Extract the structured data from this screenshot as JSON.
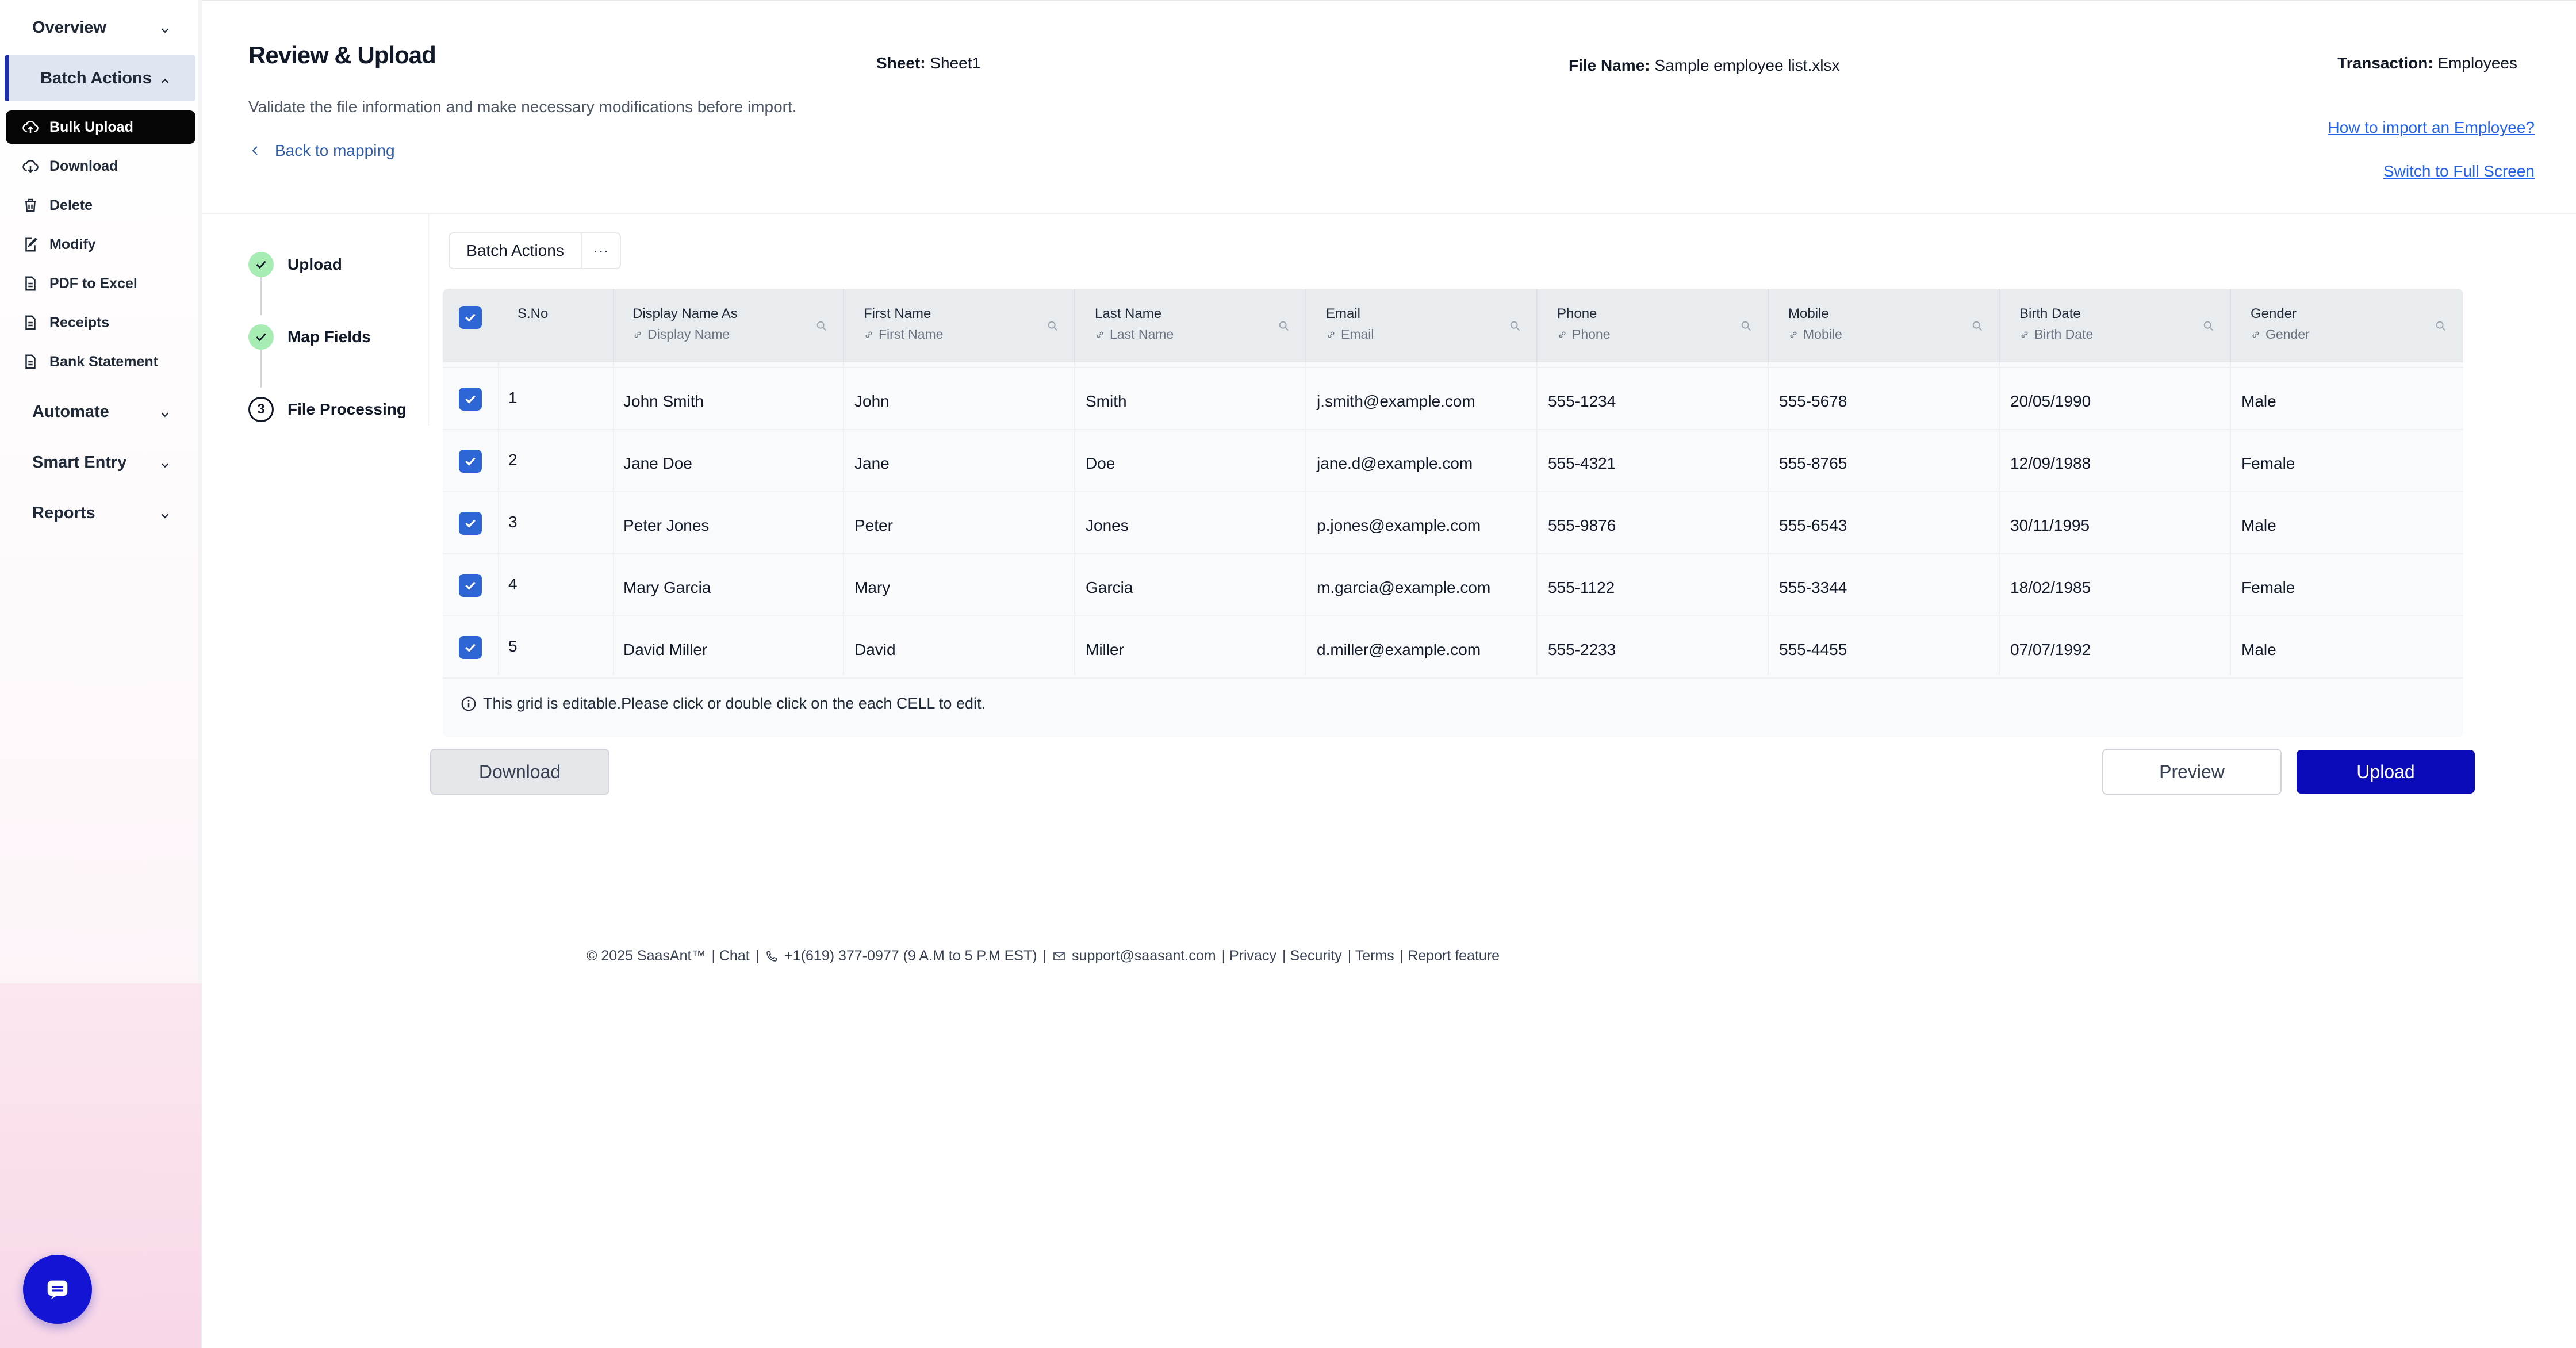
{
  "sidebar": {
    "groups": [
      {
        "label": "Overview"
      },
      {
        "label": "Batch Actions"
      },
      {
        "label": "Automate"
      },
      {
        "label": "Smart Entry"
      },
      {
        "label": "Reports"
      }
    ],
    "items": [
      {
        "label": "Bulk Upload",
        "icon": "cloud-upload-icon"
      },
      {
        "label": "Download",
        "icon": "cloud-download-icon"
      },
      {
        "label": "Delete",
        "icon": "trash-icon"
      },
      {
        "label": "Modify",
        "icon": "edit-icon"
      },
      {
        "label": "PDF to Excel",
        "icon": "document-icon"
      },
      {
        "label": "Receipts",
        "icon": "document-icon"
      },
      {
        "label": "Bank Statement",
        "icon": "document-icon"
      }
    ]
  },
  "header": {
    "title": "Review & Upload",
    "subtitle": "Validate the file information and make necessary modifications before import.",
    "back_link": "Back to mapping",
    "sheet_label": "Sheet:",
    "sheet_value": "Sheet1",
    "file_label": "File Name:",
    "file_value": "Sample employee list.xlsx",
    "transaction_label": "Transaction:",
    "transaction_value": "Employees",
    "help_link": "How to import an Employee?",
    "fullscreen_link": "Switch to Full Screen"
  },
  "steps": [
    {
      "label": "Upload",
      "status": "done"
    },
    {
      "label": "Map Fields",
      "status": "done"
    },
    {
      "label": "File Processing",
      "number": "3"
    }
  ],
  "toolbar": {
    "batch_actions": "Batch Actions",
    "more": "···"
  },
  "grid": {
    "columns": [
      {
        "title": "S.No",
        "sub": ""
      },
      {
        "title": "Display Name As",
        "sub": "Display Name"
      },
      {
        "title": "First Name",
        "sub": "First Name"
      },
      {
        "title": "Last Name",
        "sub": "Last Name"
      },
      {
        "title": "Email",
        "sub": "Email"
      },
      {
        "title": "Phone",
        "sub": "Phone"
      },
      {
        "title": "Mobile",
        "sub": "Mobile"
      },
      {
        "title": "Birth Date",
        "sub": "Birth Date"
      },
      {
        "title": "Gender",
        "sub": "Gender"
      }
    ],
    "rows": [
      [
        "1",
        "John Smith",
        "John",
        "Smith",
        "j.smith@example.com",
        "555-1234",
        "555-5678",
        "20/05/1990",
        "Male"
      ],
      [
        "2",
        "Jane Doe",
        "Jane",
        "Doe",
        "jane.d@example.com",
        "555-4321",
        "555-8765",
        "12/09/1988",
        "Female"
      ],
      [
        "3",
        "Peter Jones",
        "Peter",
        "Jones",
        "p.jones@example.com",
        "555-9876",
        "555-6543",
        "30/11/1995",
        "Male"
      ],
      [
        "4",
        "Mary Garcia",
        "Mary",
        "Garcia",
        "m.garcia@example.com",
        "555-1122",
        "555-3344",
        "18/02/1985",
        "Female"
      ],
      [
        "5",
        "David Miller",
        "David",
        "Miller",
        "d.miller@example.com",
        "555-2233",
        "555-4455",
        "07/07/1992",
        "Male"
      ]
    ],
    "note": "This grid is editable.Please click or double click on the each CELL to edit."
  },
  "buttons": {
    "download": "Download",
    "preview": "Preview",
    "upload": "Upload"
  },
  "footer": {
    "copyright": "© 2025 SaasAnt™",
    "chat": "| Chat",
    "sep1": "|",
    "phone": "+1(619) 377-0977 (9 A.M to 5 P.M EST)",
    "sep2": "|",
    "email": "support@saasant.com",
    "privacy": "| Privacy",
    "security": "| Security",
    "terms": "| Terms",
    "report": "| Report feature"
  },
  "colors": {
    "primary": "#0a0ab8",
    "checkbox": "#2f66d6",
    "step_done": "#a7ecb3",
    "active_nav_bar": "#1c2ea8"
  }
}
